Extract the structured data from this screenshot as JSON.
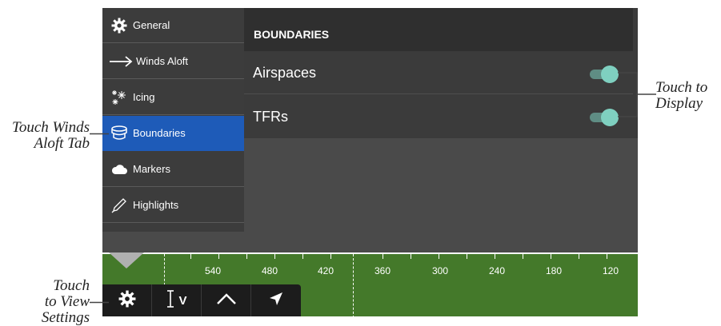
{
  "sidebar": {
    "items": [
      {
        "label": "General",
        "icon": "gear-icon"
      },
      {
        "label": "Winds Aloft",
        "icon": "arrow-right-icon"
      },
      {
        "label": "Icing",
        "icon": "snowflake-icon"
      },
      {
        "label": "Boundaries",
        "icon": "boundaries-icon",
        "active": true
      },
      {
        "label": "Markers",
        "icon": "cloud-icon"
      },
      {
        "label": "Highlights",
        "icon": "pencil-icon"
      }
    ]
  },
  "panel": {
    "header": "BOUNDARIES",
    "rows": [
      {
        "label": "Airspaces",
        "toggle_on": true
      },
      {
        "label": "TFRs",
        "toggle_on": true
      }
    ]
  },
  "profile": {
    "ticks": [
      "540",
      "480",
      "420",
      "360",
      "300",
      "240",
      "180",
      "120"
    ]
  },
  "toolbar": {
    "buttons": [
      {
        "icon": "gear-icon"
      },
      {
        "icon": "vertical-scale-icon",
        "label": "V"
      },
      {
        "icon": "profile-peak-icon"
      },
      {
        "icon": "direction-arrow-icon"
      }
    ]
  },
  "callouts": {
    "winds_tab_line1": "Touch Winds",
    "winds_tab_line2": "Aloft Tab",
    "display_line1": "Touch to",
    "display_line2": "Display",
    "view_line1": "Touch",
    "view_line2": "to View",
    "view_line3": "Settings"
  },
  "colors": {
    "active_tab": "#1e5bb8",
    "toggle_knob": "#7fd0c0",
    "profile_bg": "#44792a"
  }
}
